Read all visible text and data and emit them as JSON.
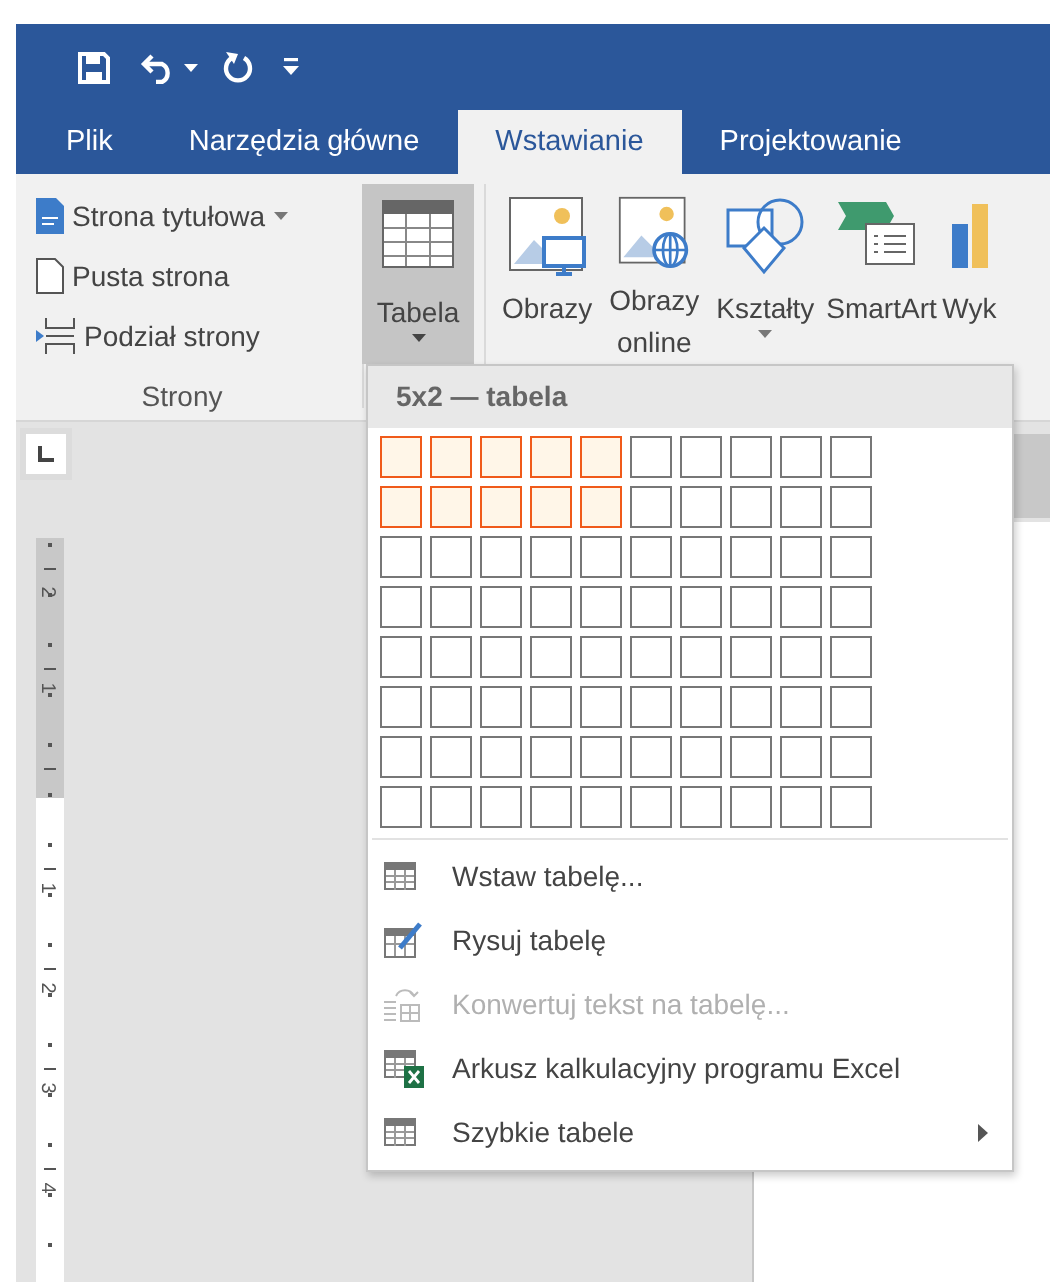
{
  "quick_access": {
    "items": [
      {
        "kind": "save"
      },
      {
        "kind": "undo"
      },
      {
        "kind": "undo-menu"
      },
      {
        "kind": "redo"
      },
      {
        "kind": "customize"
      }
    ]
  },
  "tabs": [
    {
      "label": "Plik",
      "selected": false
    },
    {
      "label": "Narzędzia główne",
      "selected": false
    },
    {
      "label": "Wstawianie",
      "selected": true
    },
    {
      "label": "Projektowanie",
      "selected": false
    }
  ],
  "ribbon": {
    "pages_group": {
      "label": "Strony",
      "items": [
        {
          "label": "Strona tytułowa",
          "dropdown": true
        },
        {
          "label": "Pusta strona",
          "dropdown": false
        },
        {
          "label": "Podział strony",
          "dropdown": false
        }
      ]
    },
    "table_button": {
      "label": "Tabela",
      "dropdown": true,
      "expanded": true
    },
    "large_buttons": [
      {
        "label": "Obrazy",
        "dropdown": false
      },
      {
        "label": "Obrazy online",
        "dropdown": false
      },
      {
        "label": "Kształty",
        "dropdown": true
      },
      {
        "label": "SmartArt",
        "dropdown": false
      },
      {
        "label": "Wyk",
        "dropdown": false
      }
    ]
  },
  "ruler": {
    "marks": [
      "2",
      "1",
      "1",
      "2",
      "3",
      "4"
    ]
  },
  "table_menu": {
    "header": "5x2 — tabela",
    "grid": [
      {
        "cells": [
          {
            "selected": true
          },
          {
            "selected": true
          },
          {
            "selected": true
          },
          {
            "selected": true
          },
          {
            "selected": true
          },
          {
            "selected": false
          },
          {
            "selected": false
          },
          {
            "selected": false
          },
          {
            "selected": false
          },
          {
            "selected": false
          }
        ]
      },
      {
        "cells": [
          {
            "selected": true
          },
          {
            "selected": true
          },
          {
            "selected": true
          },
          {
            "selected": true
          },
          {
            "selected": true
          },
          {
            "selected": false
          },
          {
            "selected": false
          },
          {
            "selected": false
          },
          {
            "selected": false
          },
          {
            "selected": false
          }
        ]
      },
      {
        "cells": [
          {
            "selected": false
          },
          {
            "selected": false
          },
          {
            "selected": false
          },
          {
            "selected": false
          },
          {
            "selected": false
          },
          {
            "selected": false
          },
          {
            "selected": false
          },
          {
            "selected": false
          },
          {
            "selected": false
          },
          {
            "selected": false
          }
        ]
      },
      {
        "cells": [
          {
            "selected": false
          },
          {
            "selected": false
          },
          {
            "selected": false
          },
          {
            "selected": false
          },
          {
            "selected": false
          },
          {
            "selected": false
          },
          {
            "selected": false
          },
          {
            "selected": false
          },
          {
            "selected": false
          },
          {
            "selected": false
          }
        ]
      },
      {
        "cells": [
          {
            "selected": false
          },
          {
            "selected": false
          },
          {
            "selected": false
          },
          {
            "selected": false
          },
          {
            "selected": false
          },
          {
            "selected": false
          },
          {
            "selected": false
          },
          {
            "selected": false
          },
          {
            "selected": false
          },
          {
            "selected": false
          }
        ]
      },
      {
        "cells": [
          {
            "selected": false
          },
          {
            "selected": false
          },
          {
            "selected": false
          },
          {
            "selected": false
          },
          {
            "selected": false
          },
          {
            "selected": false
          },
          {
            "selected": false
          },
          {
            "selected": false
          },
          {
            "selected": false
          },
          {
            "selected": false
          }
        ]
      },
      {
        "cells": [
          {
            "selected": false
          },
          {
            "selected": false
          },
          {
            "selected": false
          },
          {
            "selected": false
          },
          {
            "selected": false
          },
          {
            "selected": false
          },
          {
            "selected": false
          },
          {
            "selected": false
          },
          {
            "selected": false
          },
          {
            "selected": false
          }
        ]
      },
      {
        "cells": [
          {
            "selected": false
          },
          {
            "selected": false
          },
          {
            "selected": false
          },
          {
            "selected": false
          },
          {
            "selected": false
          },
          {
            "selected": false
          },
          {
            "selected": false
          },
          {
            "selected": false
          },
          {
            "selected": false
          },
          {
            "selected": false
          }
        ]
      }
    ],
    "items": [
      {
        "label": "Wstaw tabelę...",
        "disabled": false,
        "submenu": false
      },
      {
        "label": "Rysuj tabelę",
        "disabled": false,
        "submenu": false
      },
      {
        "label": "Konwertuj tekst na tabelę...",
        "disabled": true,
        "submenu": false
      },
      {
        "label": "Arkusz kalkulacyjny programu Excel",
        "disabled": false,
        "submenu": false
      },
      {
        "label": "Szybkie tabele",
        "disabled": false,
        "submenu": true
      }
    ]
  }
}
